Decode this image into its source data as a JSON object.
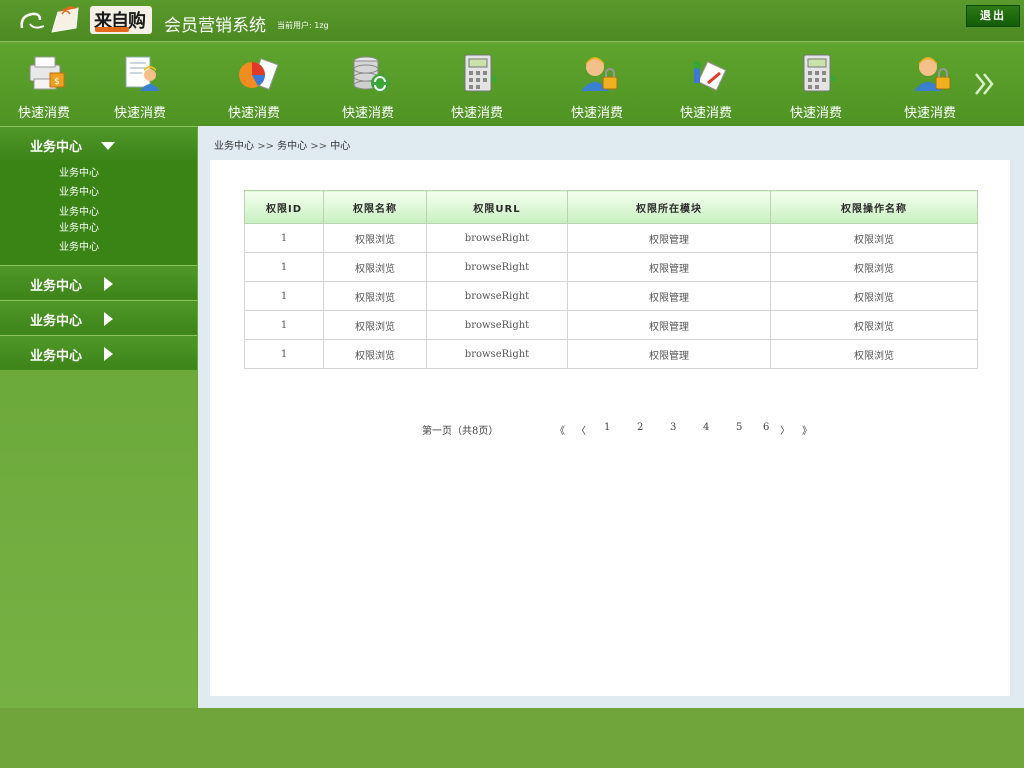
{
  "header": {
    "logo_text": "来自购",
    "app_title": "会员营销系统",
    "current_user_label": "当前用户:",
    "current_user_name": "1zg",
    "logout_label": "退出"
  },
  "toolbar": {
    "items": [
      {
        "label": "快速消费",
        "icon": "printer-icon"
      },
      {
        "label": "快速消费",
        "icon": "user-document-icon"
      },
      {
        "label": "快速消费",
        "icon": "pie-chart-icon"
      },
      {
        "label": "快速消费",
        "icon": "database-refresh-icon"
      },
      {
        "label": "快速消费",
        "icon": "calculator-icon"
      },
      {
        "label": "快速消费",
        "icon": "user-lock-icon"
      },
      {
        "label": "快速消费",
        "icon": "chart-tools-icon"
      },
      {
        "label": "快速消费",
        "icon": "calculator-icon"
      },
      {
        "label": "快速消费",
        "icon": "user-lock-icon"
      }
    ],
    "more_icon": "double-chevron-right-icon"
  },
  "sidebar": {
    "groups": [
      {
        "label": "业务中心",
        "expanded": true,
        "items": [
          "业务中心",
          "业务中心",
          "业务中心",
          "业务中心",
          "业务中心"
        ]
      },
      {
        "label": "业务中心",
        "expanded": false
      },
      {
        "label": "业务中心",
        "expanded": false
      },
      {
        "label": "业务中心",
        "expanded": false
      }
    ]
  },
  "breadcrumb": {
    "items": [
      "业务中心",
      "务中心",
      "中心"
    ],
    "separator": ">>"
  },
  "table": {
    "columns": [
      "权限ID",
      "权限名称",
      "权限URL",
      "权限所在模块",
      "权限操作名称"
    ],
    "rows": [
      [
        "1",
        "权限浏览",
        "browseRight",
        "权限管理",
        "权限浏览"
      ],
      [
        "1",
        "权限浏览",
        "browseRight",
        "权限管理",
        "权限浏览"
      ],
      [
        "1",
        "权限浏览",
        "browseRight",
        "权限管理",
        "权限浏览"
      ],
      [
        "1",
        "权限浏览",
        "browseRight",
        "权限管理",
        "权限浏览"
      ],
      [
        "1",
        "权限浏览",
        "browseRight",
        "权限管理",
        "权限浏览"
      ]
    ]
  },
  "pager": {
    "info": "第一页（共8页）",
    "first": "《",
    "prev": "〈",
    "pages": [
      "1",
      "2",
      "3",
      "4",
      "5",
      "6"
    ],
    "next": "〉",
    "last": "》"
  },
  "colors": {
    "brand_green": "#5fa42d",
    "sidebar_green": "#3f8a1f",
    "header_green": "#4f9324",
    "content_bg": "#dfeaf1"
  }
}
